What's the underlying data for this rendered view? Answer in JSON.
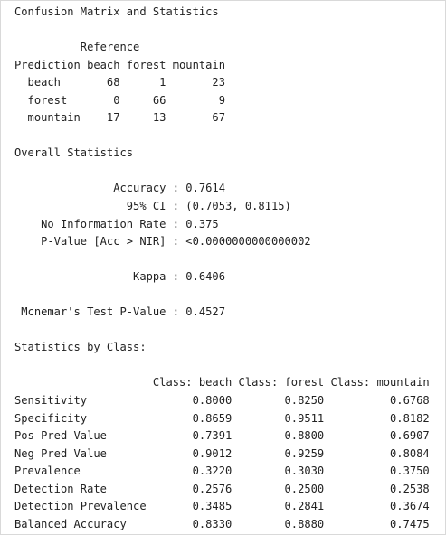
{
  "lines": [
    "Confusion Matrix and Statistics",
    "",
    "          Reference",
    "Prediction beach forest mountain",
    "  beach       68      1       23",
    "  forest       0     66        9",
    "  mountain    17     13       67",
    "",
    "Overall Statistics",
    "",
    "               Accuracy : 0.7614",
    "                 95% CI : (0.7053, 0.8115)",
    "    No Information Rate : 0.375",
    "    P-Value [Acc > NIR] : <0.0000000000000002",
    "",
    "                  Kappa : 0.6406",
    "",
    " Mcnemar's Test P-Value : 0.4527",
    "",
    "Statistics by Class:",
    "",
    "                     Class: beach Class: forest Class: mountain",
    "Sensitivity                0.8000        0.8250          0.6768",
    "Specificity                0.8659        0.9511          0.8182",
    "Pos Pred Value             0.7391        0.8800          0.6907",
    "Neg Pred Value             0.9012        0.9259          0.8084",
    "Prevalence                 0.3220        0.3030          0.3750",
    "Detection Rate             0.2576        0.2500          0.2538",
    "Detection Prevalence       0.3485        0.2841          0.3674",
    "Balanced Accuracy          0.8330        0.8880          0.7475"
  ]
}
